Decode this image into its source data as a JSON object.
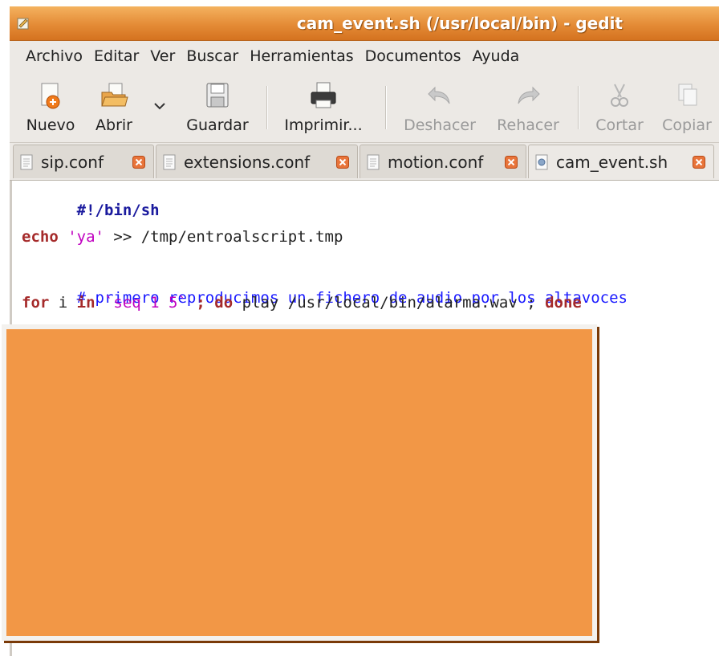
{
  "window": {
    "title": "cam_event.sh (/usr/local/bin) - gedit"
  },
  "menubar": {
    "items": [
      "Archivo",
      "Editar",
      "Ver",
      "Buscar",
      "Herramientas",
      "Documentos",
      "Ayuda"
    ]
  },
  "toolbar": {
    "new_label": "Nuevo",
    "open_label": "Abrir",
    "save_label": "Guardar",
    "print_label": "Imprimir...",
    "undo_label": "Deshacer",
    "redo_label": "Rehacer",
    "cut_label": "Cortar",
    "copy_label": "Copiar"
  },
  "tabs": [
    {
      "label": "sip.conf"
    },
    {
      "label": "extensions.conf"
    },
    {
      "label": "motion.conf"
    },
    {
      "label": "cam_event.sh",
      "active": true
    }
  ],
  "editor": {
    "line1": "#!/bin/sh",
    "line3_kw": "echo",
    "line3_str": "'ya'",
    "line3_rest": " >> /tmp/entroalscript.tmp",
    "line5": "# primero reproducimos un fichero de audio por los altavoces",
    "line6_for": "for",
    "line6_i": " i ",
    "line6_in": "in",
    "line6_seq": " `seq 1 5`",
    "line6_semi": " ; ",
    "line6_do": "do",
    "line6_play": " play /usr/local/bin/alarma.wav ; ",
    "line6_done": "done"
  },
  "colors": {
    "titlebar": "#e48b36",
    "overlay": "#f29746",
    "keyword": "#a52a2a",
    "string": "#c000c0",
    "comment": "#1a1aff"
  }
}
